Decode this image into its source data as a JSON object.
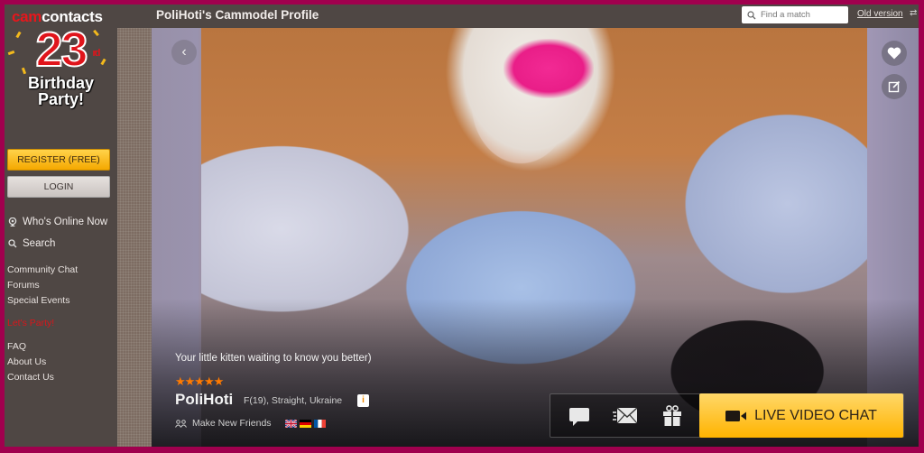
{
  "brand": {
    "prefix": "cam",
    "suffix": "contacts"
  },
  "promo": {
    "number": "23",
    "ordinal": "rd",
    "line1": "Birthday",
    "line2": "Party!"
  },
  "sidebar": {
    "register_label": "REGISTER (FREE)",
    "login_label": "LOGIN",
    "main_links": [
      {
        "label": "Who's Online Now",
        "icon": "webcam-icon"
      },
      {
        "label": "Search",
        "icon": "search-icon"
      }
    ],
    "links": [
      "Community Chat",
      "Forums",
      "Special Events"
    ],
    "highlight_link": "Let's Party!",
    "footer_links": [
      "FAQ",
      "About Us",
      "Contact Us"
    ]
  },
  "header": {
    "title": "PoliHoti's Cammodel Profile",
    "search_placeholder": "Find a match",
    "old_version_label": "Old version"
  },
  "profile": {
    "tagline": "Your little kitten waiting to know you better)",
    "rating": "★★★★★",
    "rating_value": 5,
    "name": "PoliHoti",
    "details": "F(19), Straight, Ukraine",
    "info_label": "i",
    "looking_for": "Make New Friends",
    "languages": [
      "English",
      "German",
      "French"
    ]
  },
  "actions": {
    "chat_icon": "speech-bubble-icon",
    "mail_icon": "envelope-icon",
    "gift_icon": "gift-icon",
    "live_label": "LIVE VIDEO CHAT"
  },
  "colors": {
    "frame": "#a0004e",
    "panel": "#4f4744",
    "accent_yellow": "#ffb300",
    "star": "#ff7a00",
    "brand_red": "#e0141b"
  }
}
